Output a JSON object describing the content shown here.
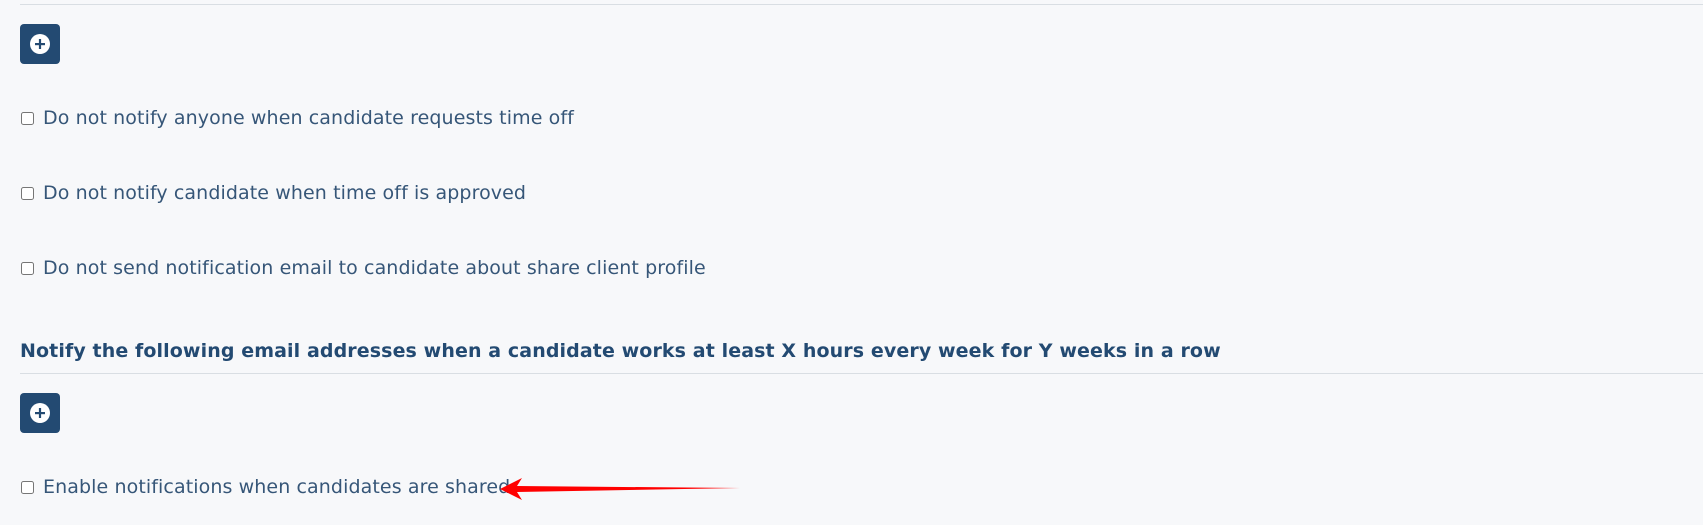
{
  "sections": [
    {
      "add_icon": "plus-circle-icon",
      "options": [
        {
          "label": "Do not notify anyone when candidate requests time off",
          "checked": false
        },
        {
          "label": "Do not notify candidate when time off is approved",
          "checked": false
        },
        {
          "label": "Do not send notification email to candidate about share client profile",
          "checked": false
        }
      ]
    },
    {
      "heading": "Notify the following email addresses when a candidate works at least X hours every week for Y weeks in a row",
      "add_icon": "plus-circle-icon",
      "options": [
        {
          "label": "Enable notifications when candidates are shared",
          "checked": false
        }
      ]
    }
  ],
  "annotation": {
    "icon": "red-arrow-icon",
    "color": "#ff0000"
  },
  "colors": {
    "primary": "#234a72",
    "text": "#365678",
    "background": "#f7f8fa"
  }
}
